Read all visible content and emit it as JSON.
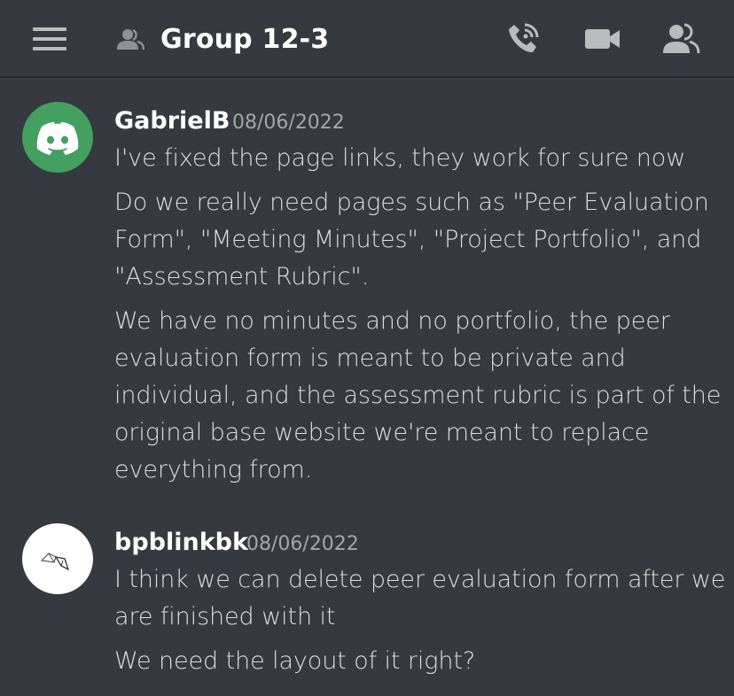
{
  "header": {
    "menu_icon": "hamburger-menu-icon",
    "channel_icon": "group-dm-icon",
    "title": "Group 12-3",
    "actions": [
      {
        "name": "voice-call",
        "icon": "phone-call-icon"
      },
      {
        "name": "video-call",
        "icon": "video-camera-icon"
      },
      {
        "name": "members",
        "icon": "members-icon"
      }
    ]
  },
  "messages": [
    {
      "author": "GabrielB",
      "timestamp": "08/06/2022",
      "avatar_icon": "discord-logo-icon",
      "avatar_color": "#43a061",
      "lines": [
        "I've fixed the page links, they work for sure now",
        "Do we really need pages such as \"Peer Evaluation Form\", \"Meeting Minutes\", \"Project Portfolio\", and \"Assessment Rubric\".",
        "We have no minutes and no portfolio, the peer evaluation form is meant to be private and individual, and the assessment rubric is part of the original base website we're meant to replace everything from."
      ]
    },
    {
      "author": "bpblinkbk",
      "timestamp": "08/06/2022",
      "avatar_icon": "sketch-doodle-icon",
      "avatar_color": "#ffffff",
      "lines": [
        "I think we can delete peer evaluation form after we are finished with it",
        "We need the layout of it right?"
      ]
    }
  ],
  "colors": {
    "background": "#36393f",
    "text": "#dcddde",
    "username": "#ffffff",
    "timestamp": "#a3a6aa",
    "icon": "#b9bbbe"
  }
}
